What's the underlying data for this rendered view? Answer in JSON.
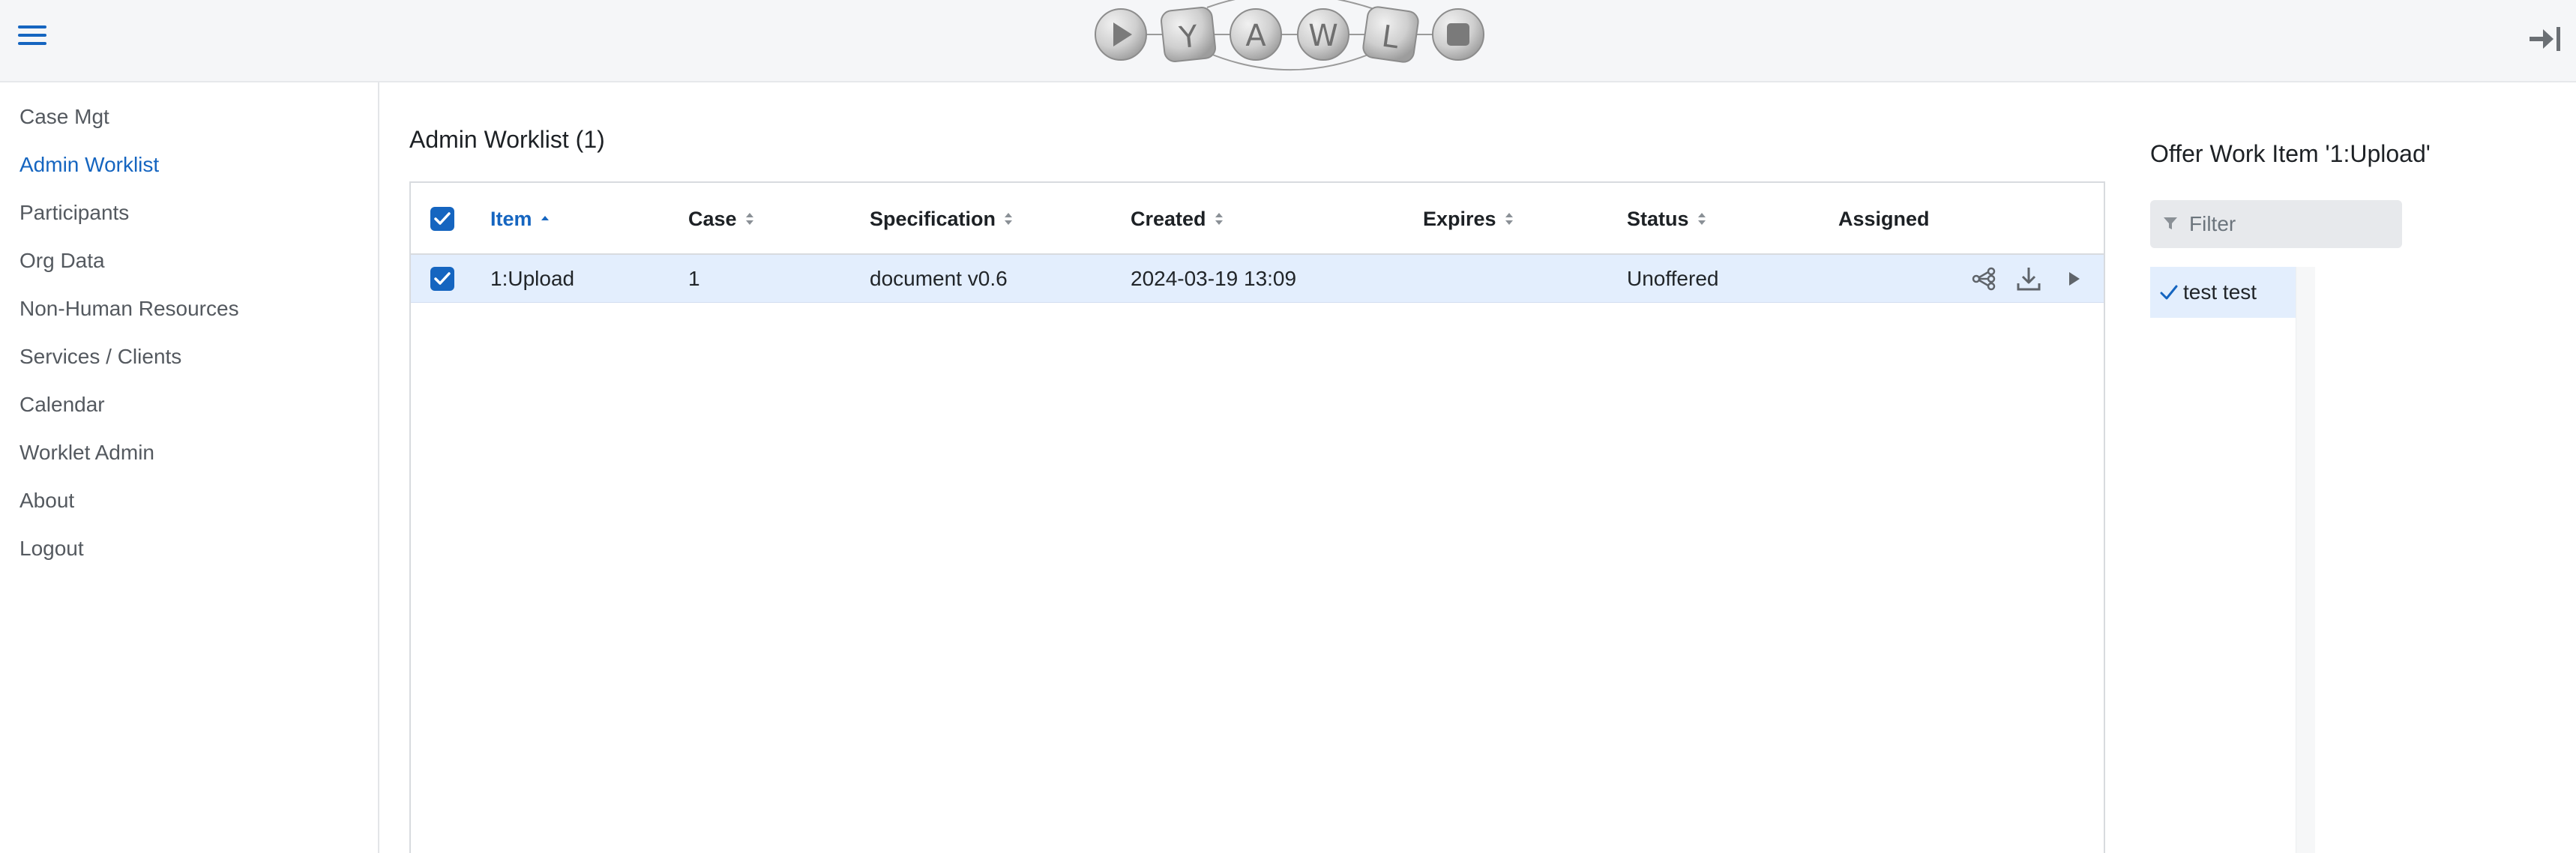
{
  "header": {
    "menu_icon": "hamburger-menu-icon",
    "logo_letters": [
      "Y",
      "A",
      "W",
      "L"
    ],
    "logout_icon": "sign-out-arrow-icon",
    "accent_color": "#1565c0"
  },
  "sidebar": {
    "items": [
      {
        "label": "Case Mgt",
        "active": false
      },
      {
        "label": "Admin Worklist",
        "active": true
      },
      {
        "label": "Participants",
        "active": false
      },
      {
        "label": "Org Data",
        "active": false
      },
      {
        "label": "Non-Human Resources",
        "active": false
      },
      {
        "label": "Services / Clients",
        "active": false
      },
      {
        "label": "Calendar",
        "active": false
      },
      {
        "label": "Worklet Admin",
        "active": false
      },
      {
        "label": "About",
        "active": false
      },
      {
        "label": "Logout",
        "active": false
      }
    ]
  },
  "worklist": {
    "title": "Admin Worklist (1)",
    "columns": {
      "item": "Item",
      "case": "Case",
      "specification": "Specification",
      "created": "Created",
      "expires": "Expires",
      "status": "Status",
      "assigned": "Assigned"
    },
    "sorted_column": "item",
    "sort_direction": "ascending",
    "select_all_checked": true,
    "rows": [
      {
        "selected": true,
        "item": "1:Upload",
        "case": "1",
        "specification": "document v0.6",
        "created": "2024-03-19 13:09",
        "expires": "",
        "status": "Unoffered",
        "assigned": "",
        "actions": [
          "hierarchy-icon",
          "download-icon",
          "play-icon"
        ]
      }
    ]
  },
  "offer_panel": {
    "title": "Offer Work Item '1:Upload'",
    "filter_placeholder": "Filter",
    "participants": [
      {
        "label": "test test",
        "selected": true
      }
    ]
  }
}
